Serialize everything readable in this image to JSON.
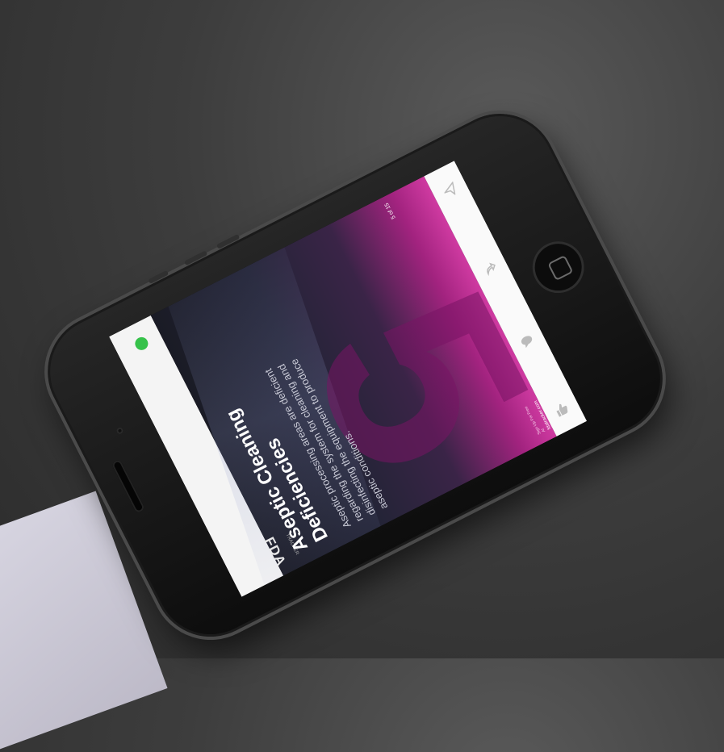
{
  "card": {
    "logo": "FDA",
    "logo_sub": "TRACKER",
    "title": "Aseptic Cleaning Deficiencies",
    "body": "Aseptic processing areas are deficient regarding the system for cleaning and disinfecting the equipment to produce aseptic conditions.",
    "number": "5",
    "page_count": "5 of 15",
    "footer_label": "Sign Up For Free At",
    "footer_link": "fdatracker.com"
  },
  "toolbar": {
    "icons": [
      "like-icon",
      "comment-icon",
      "share-icon",
      "send-icon"
    ]
  },
  "colors": {
    "gradient_start": "#1a1b25",
    "gradient_end": "#cf3aa1",
    "status_dot": "#36c24a"
  }
}
